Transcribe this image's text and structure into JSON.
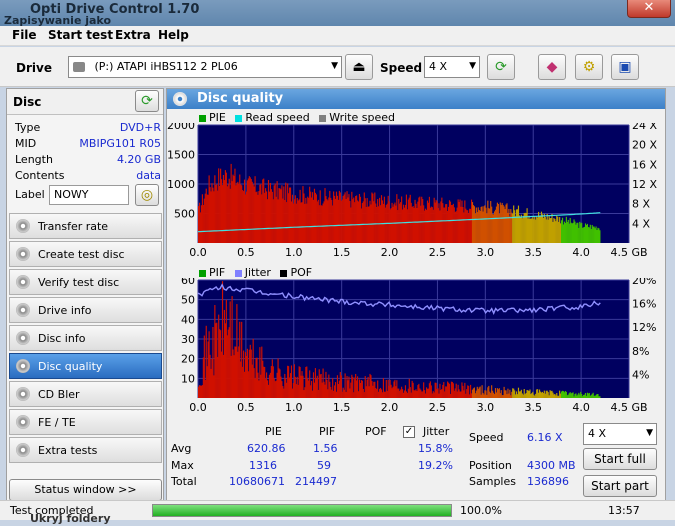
{
  "window": {
    "title": "Opti Drive Control 1.70",
    "subtitle": "Zapisywanie jako",
    "close_glyph": "✕"
  },
  "menu": [
    "File",
    "Start test",
    "Extra",
    "Help"
  ],
  "toolbar": {
    "drive_label": "Drive",
    "drive_value": "(P:)   ATAPI iHBS112   2 PL06",
    "speed_label": "Speed",
    "speed_value": "4 X"
  },
  "disc": {
    "header": "Disc",
    "type_key": "Type",
    "type_value": "DVD+R",
    "mid_key": "MID",
    "mid_value": "MBIPG101 R05",
    "length_key": "Length",
    "length_value": "4.20 GB",
    "contents_key": "Contents",
    "contents_value": "data",
    "label_key": "Label",
    "label_value": "NOWY"
  },
  "nav": [
    {
      "label": "Transfer rate",
      "active": false
    },
    {
      "label": "Create test disc",
      "active": false
    },
    {
      "label": "Verify test disc",
      "active": false
    },
    {
      "label": "Drive info",
      "active": false
    },
    {
      "label": "Disc info",
      "active": false
    },
    {
      "label": "Disc quality",
      "active": true
    },
    {
      "label": "CD Bler",
      "active": false
    },
    {
      "label": "FE / TE",
      "active": false
    },
    {
      "label": "Extra tests",
      "active": false
    }
  ],
  "status_window_label": "Status window >>",
  "panel": {
    "title": "Disc quality"
  },
  "legend_top": [
    {
      "name": "PIE",
      "color": "#00a000"
    },
    {
      "name": "Read speed",
      "color": "#00e0e0"
    },
    {
      "name": "Write speed",
      "color": "#808080"
    }
  ],
  "legend_bottom": [
    {
      "name": "PIF",
      "color": "#00a000"
    },
    {
      "name": "Jitter",
      "color": "#8080ff"
    },
    {
      "name": "POF",
      "color": "#000000"
    }
  ],
  "chart_data": [
    {
      "type": "area",
      "name": "PIE / Read speed",
      "x_ticks": [
        "0.0",
        "0.5",
        "1.0",
        "1.5",
        "2.0",
        "2.5",
        "3.0",
        "3.5",
        "4.0",
        "4.5 GB"
      ],
      "xlim": [
        0,
        4.5
      ],
      "y_left_ticks": [
        "2000",
        "1500",
        "1000",
        "500"
      ],
      "ylim_left": [
        0,
        2000
      ],
      "y_right_ticks": [
        "24 X",
        "20 X",
        "16 X",
        "12 X",
        "8 X",
        "4 X"
      ],
      "ylim_right": [
        0,
        24
      ],
      "series": [
        {
          "name": "PIE",
          "x": [
            0.0,
            0.1,
            0.2,
            0.3,
            0.4,
            0.5,
            0.75,
            1.0,
            1.5,
            2.0,
            2.5,
            3.0,
            3.25,
            3.5,
            3.75,
            4.0,
            4.2
          ],
          "values": [
            620,
            1100,
            1250,
            1316,
            1220,
            1120,
            1030,
            950,
            860,
            800,
            760,
            700,
            640,
            560,
            480,
            340,
            300
          ]
        },
        {
          "name": "Read speed",
          "x": [
            0.0,
            1.0,
            2.0,
            3.0,
            4.0,
            4.2
          ],
          "values": [
            2.3,
            3.2,
            4.0,
            4.9,
            5.9,
            6.16
          ]
        }
      ]
    },
    {
      "type": "area",
      "name": "PIF / Jitter",
      "x_ticks": [
        "0.0",
        "0.5",
        "1.0",
        "1.5",
        "2.0",
        "2.5",
        "3.0",
        "3.5",
        "4.0",
        "4.5 GB"
      ],
      "xlim": [
        0,
        4.5
      ],
      "y_left_ticks": [
        "60",
        "50",
        "40",
        "30",
        "20",
        "10"
      ],
      "ylim_left": [
        0,
        60
      ],
      "y_right_ticks": [
        "20%",
        "16%",
        "12%",
        "8%",
        "4%"
      ],
      "ylim_right": [
        0,
        20
      ],
      "series": [
        {
          "name": "PIF",
          "x": [
            0.0,
            0.1,
            0.2,
            0.3,
            0.4,
            0.5,
            0.75,
            1.0,
            1.5,
            2.0,
            2.5,
            3.0,
            3.5,
            4.0,
            4.2
          ],
          "values": [
            20,
            35,
            45,
            59,
            42,
            30,
            20,
            15,
            12,
            10,
            8,
            6,
            4,
            3,
            2
          ]
        },
        {
          "name": "Jitter",
          "x": [
            0.0,
            0.25,
            0.5,
            1.0,
            1.5,
            2.0,
            2.5,
            3.0,
            3.5,
            4.0,
            4.2
          ],
          "values": [
            17.5,
            18.8,
            18.2,
            17.2,
            16.4,
            15.8,
            15.2,
            14.8,
            14.9,
            15.5,
            16.2
          ]
        }
      ]
    }
  ],
  "stats": {
    "col_pie": "PIE",
    "col_pif": "PIF",
    "col_pof": "POF",
    "col_jitter": "Jitter",
    "avg_label": "Avg",
    "avg_pie": "620.86",
    "avg_pif": "1.56",
    "avg_jitter": "15.8%",
    "max_label": "Max",
    "max_pie": "1316",
    "max_pif": "59",
    "max_jitter": "19.2%",
    "total_label": "Total",
    "total_pie": "10680671",
    "total_pif": "214497",
    "speed_label": "Speed",
    "speed_value": "6.16 X",
    "position_label": "Position",
    "position_value": "4300 MB",
    "samples_label": "Samples",
    "samples_value": "136896",
    "speed_select": "4 X",
    "start_full": "Start full",
    "start_part": "Start part"
  },
  "statusbar": {
    "status": "Test completed",
    "progress": 1.0,
    "percent": "100.0%",
    "time": "13:57"
  },
  "below_text": "Ukryj foldery"
}
